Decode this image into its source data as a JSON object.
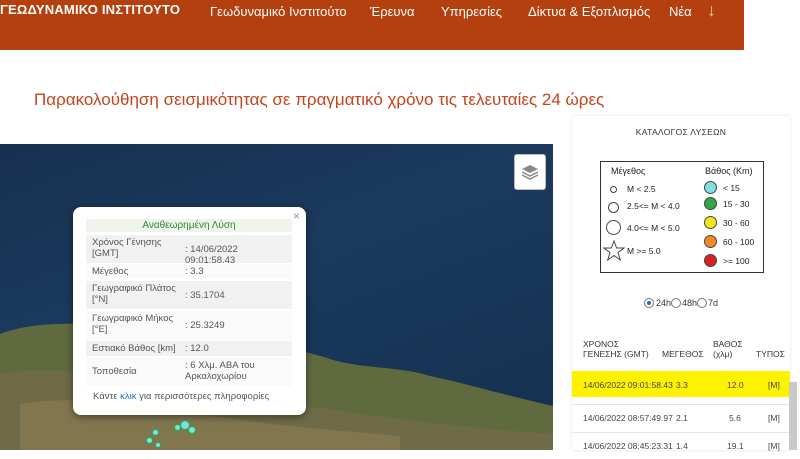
{
  "header": {
    "logo": "ΓΕΩΔΥΝΑΜΙΚΟ ΙΝΣΤΙΤΟΥΤΟ",
    "nav": [
      "Γεωδυναμικό Ινστιτούτο",
      "Έρευνα",
      "Υπηρεσίες",
      "Δίκτυα & Εξοπλισμός",
      "Νέα"
    ],
    "arrow": "↓"
  },
  "page": {
    "title": "Παρακολούθηση σεισμικότητας σε πραγματικό χρόνο τις τελευταίες 24 ώρες"
  },
  "popup": {
    "header": "Αναθεωρημένη Λύση",
    "close": "×",
    "rows": [
      {
        "label": "Χρόνος Γένησης [GMT]",
        "value": ": 14/06/2022 09:01:58.43"
      },
      {
        "label": "Μέγεθος",
        "value": ": 3.3"
      },
      {
        "label": "Γεωγραφικό Πλάτος [°N]",
        "value": ": 35.1704"
      },
      {
        "label": "Γεωγραφικό Μήκος [°E]",
        "value": ": 25.3249"
      },
      {
        "label": "Εστιακό Βάθος [km]",
        "value": ": 12.0"
      },
      {
        "label": "Τοποθεσία",
        "value": ": 6 Χλμ. ΑΒΑ του Αρκαλοχωρίου"
      }
    ],
    "more_prefix": "Κάντε",
    "more_link": "κλικ",
    "more_suffix": "για περισσότερες πληροφορίες"
  },
  "catalog": {
    "title": "ΚΑΤΑΛΟΓΟΣ ΛΥΣΕΩΝ",
    "legend": {
      "magnitude_title": "Μέγεθος",
      "depth_title": "Βάθος (Km)",
      "magnitudes": [
        "M < 2.5",
        "2.5<= M < 4.0",
        "4.0<= M < 5.0",
        "M >= 5.0"
      ],
      "depths": [
        {
          "label": "< 15",
          "color": "#7fe0df"
        },
        {
          "label": "15 - 30",
          "color": "#2fa84a"
        },
        {
          "label": "30 - 60",
          "color": "#f2e61c"
        },
        {
          "label": "60 - 100",
          "color": "#f08a24"
        },
        {
          "label": ">= 100",
          "color": "#d62222"
        }
      ]
    },
    "ranges": [
      "24h",
      "48h",
      "7d"
    ],
    "selected_range": "24h",
    "columns": {
      "time": "ΧΡΟΝΟΣ ΓΕΝΕΣΗΣ (GMT)",
      "magnitude": "ΜΕΓΕΘΟΣ",
      "depth": "ΒΑΘΟΣ (χλμ)",
      "type": "ΤΥΠΟΣ"
    },
    "rows": [
      {
        "time": "14/06/2022 09:01:58.43",
        "magnitude": "3.3",
        "depth": "12.0",
        "type": "[M]"
      },
      {
        "time": "14/06/2022 08:57:49.97",
        "magnitude": "2.1",
        "depth": "5.6",
        "type": "[M]"
      },
      {
        "time": "14/06/2022 08:45:23.31",
        "magnitude": "1.4",
        "depth": "19.1",
        "type": "[M]"
      }
    ],
    "highlight_color": "#fff200"
  }
}
